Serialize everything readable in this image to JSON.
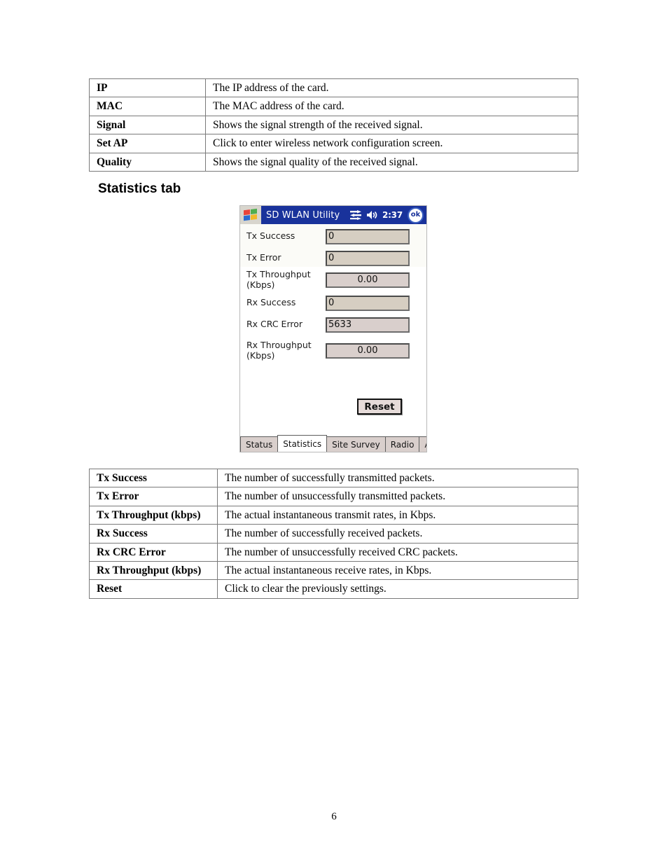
{
  "document": {
    "page_number": "6",
    "section_heading": "Statistics tab"
  },
  "status_table": {
    "rows": [
      {
        "key": "IP",
        "desc": "The IP address of the card."
      },
      {
        "key": "MAC",
        "desc": "The MAC address of the card."
      },
      {
        "key": "Signal",
        "desc": "Shows the signal strength of the received signal."
      },
      {
        "key": "Set AP",
        "desc": "Click to enter wireless network configuration screen."
      },
      {
        "key": "Quality",
        "desc": "Shows the signal quality of the received signal."
      }
    ]
  },
  "statistics_table": {
    "rows": [
      {
        "key": "Tx Success",
        "desc": "The number of successfully transmitted packets."
      },
      {
        "key": "Tx Error",
        "desc": "The number of unsuccessfully transmitted packets."
      },
      {
        "key": "Tx Throughput (kbps)",
        "desc": "The actual instantaneous transmit rates, in Kbps."
      },
      {
        "key": "Rx Success",
        "desc": "The number of successfully received packets."
      },
      {
        "key": "Rx CRC Error",
        "desc": "The number of unsuccessfully received CRC packets."
      },
      {
        "key": "Rx Throughput (kbps)",
        "desc": "The actual instantaneous receive rates, in Kbps."
      },
      {
        "key": "Reset",
        "desc": "Click to clear the previously settings."
      }
    ]
  },
  "pda": {
    "titlebar": {
      "start_icon": "windows-flag-icon",
      "title": "SD WLAN Utility",
      "connectivity_icon": "connectivity-icon",
      "volume_icon": "speaker-icon",
      "clock": "2:37",
      "ok_label": "ok"
    },
    "fields": [
      {
        "label": "Tx Success",
        "value": "0",
        "style": "counter"
      },
      {
        "label": "Tx Error",
        "value": "0",
        "style": "counter"
      },
      {
        "label": "Tx Throughput\n(Kbps)",
        "label_line1": "Tx Throughput",
        "label_line2": "(Kbps)",
        "value": "0.00",
        "style": "rate"
      },
      {
        "label": "Rx Success",
        "value": "0",
        "style": "counter"
      },
      {
        "label": "Rx CRC Error",
        "value": "5633",
        "style": "crc"
      },
      {
        "label": "Rx Throughput\n(Kbps)",
        "label_line1": "Rx Throughput",
        "label_line2": "(Kbps)",
        "value": "0.00",
        "style": "rate"
      }
    ],
    "reset_label": "Reset",
    "tabs": [
      {
        "label": "Status",
        "active": false
      },
      {
        "label": "Statistics",
        "active": true
      },
      {
        "label": "Site Survey",
        "active": false
      },
      {
        "label": "Radio",
        "active": false
      },
      {
        "label": "About",
        "active": false
      }
    ],
    "sip": {
      "keyboard_icon": "keyboard-icon",
      "selector_icon": "chevron-up-icon"
    }
  },
  "colors": {
    "titlebar_blue": "#19329b",
    "field_fill": "#d9cfcc",
    "counter_fill": "#d6cec2",
    "tab_fill": "#d9cfcc",
    "sip_fill": "#ddd2d0"
  }
}
